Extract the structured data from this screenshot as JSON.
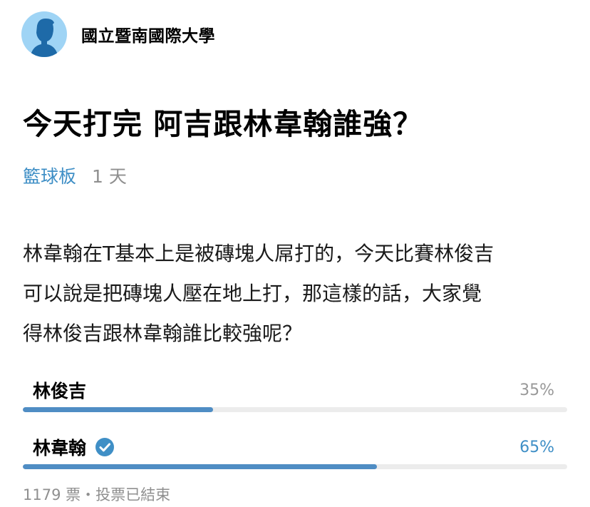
{
  "header": {
    "school": "國立暨南國際大學",
    "avatar_icon": "person-silhouette-icon"
  },
  "post": {
    "title": "今天打完 阿吉跟林韋翰誰強？",
    "board": "籃球板",
    "time": "1 天",
    "body": "林韋翰在T基本上是被磚塊人屌打的，今天比賽林俊吉\n可以說是把磚塊人壓在地上打，那這樣的話，大家覺\n得林俊吉跟林韋翰誰比較強呢？"
  },
  "poll": {
    "options": [
      {
        "label": "林俊吉",
        "percent_label": "35%",
        "fraction": 0.35,
        "winner": false
      },
      {
        "label": "林韋翰",
        "percent_label": "65%",
        "fraction": 0.65,
        "winner": true,
        "badge_icon": "check-circle-icon"
      }
    ],
    "footer": "1179 票・投票已結束"
  },
  "colors": {
    "accent": "#3f8fc6",
    "bar_fill": "#4f8dc4",
    "bar_track": "#ececec",
    "muted": "#8f8f8f",
    "avatar_bg": "#9fd4f5"
  }
}
